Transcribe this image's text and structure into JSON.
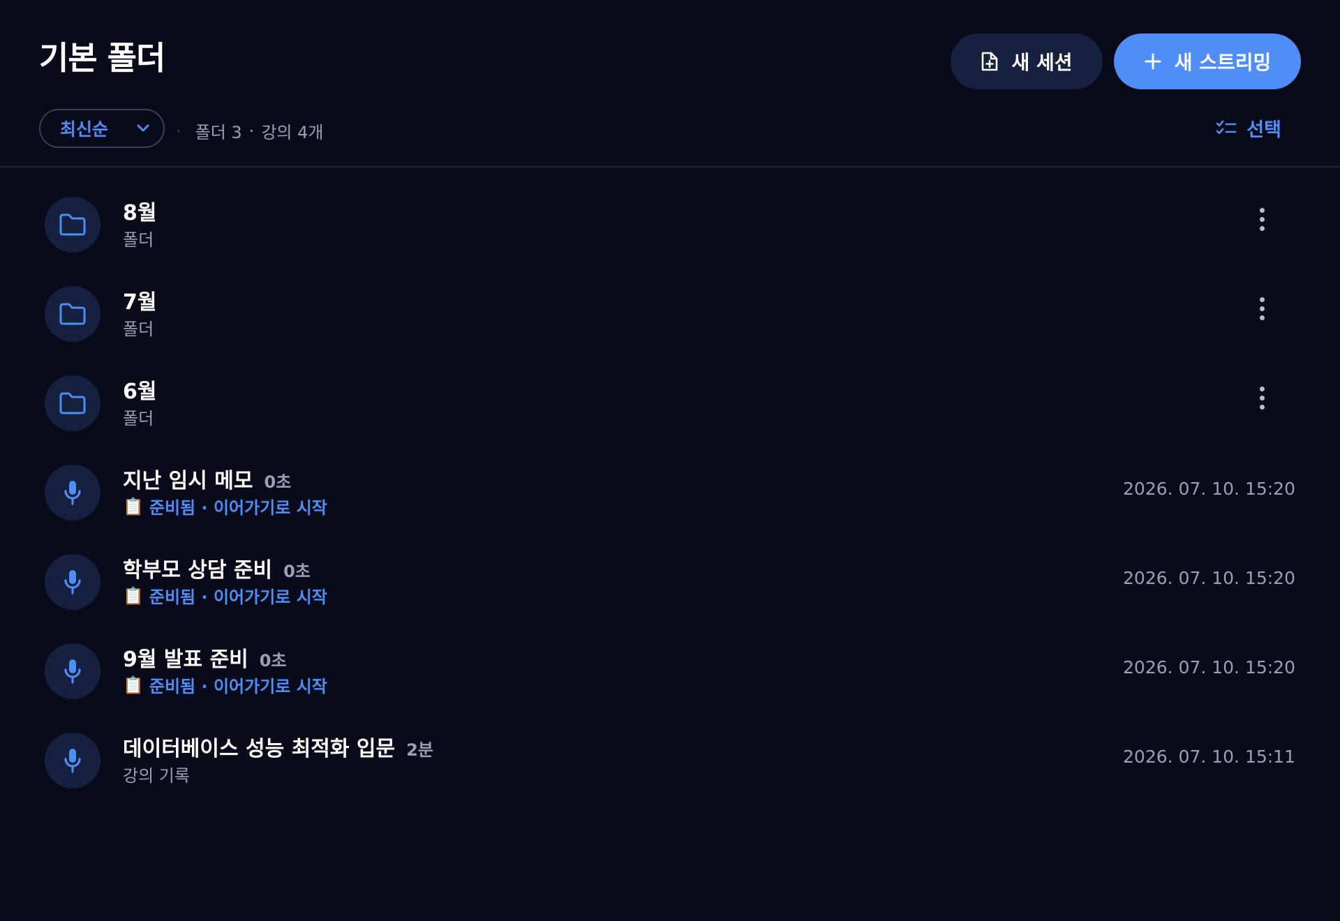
{
  "header": {
    "title": "기본 폴더",
    "new_session_label": "새 세션",
    "new_streaming_label": "새 스트리밍"
  },
  "toolbar": {
    "sort_value": "최신순",
    "summary_folders": "폴더 3",
    "summary_separator": "·",
    "summary_lectures": "강의 4개",
    "select_label": "선택"
  },
  "folders": [
    {
      "name": "8월",
      "type_label": "폴더"
    },
    {
      "name": "7월",
      "type_label": "폴더"
    },
    {
      "name": "6월",
      "type_label": "폴더"
    }
  ],
  "lectures": [
    {
      "title": "지난 임시 메모",
      "duration": "0초",
      "status": "준비됨 · 이어가기로 시작",
      "date": "2026. 07. 10. 15:20"
    },
    {
      "title": "학부모 상담 준비",
      "duration": "0초",
      "status": "준비됨 · 이어가기로 시작",
      "date": "2026. 07. 10. 15:20"
    },
    {
      "title": "9월 발표 준비",
      "duration": "0초",
      "status": "준비됨 · 이어가기로 시작",
      "date": "2026. 07. 10. 15:20"
    },
    {
      "title": "데이터베이스 성능 최적화 입문",
      "duration": "2분",
      "subtitle": "강의 기록",
      "date": "2026. 07. 10. 15:11"
    }
  ],
  "colors": {
    "background": "#0a0b1a",
    "accent": "#4f8ef7",
    "avatar_bg": "#16203f",
    "muted_text": "#9aa0b4"
  },
  "icons": {
    "folder": "folder-icon",
    "lecture": "microphone-icon",
    "new_session": "file-plus-icon",
    "new_streaming": "plus-icon",
    "select": "checklist-icon",
    "sort": "chevron-down-icon",
    "status": "clipboard-icon"
  }
}
